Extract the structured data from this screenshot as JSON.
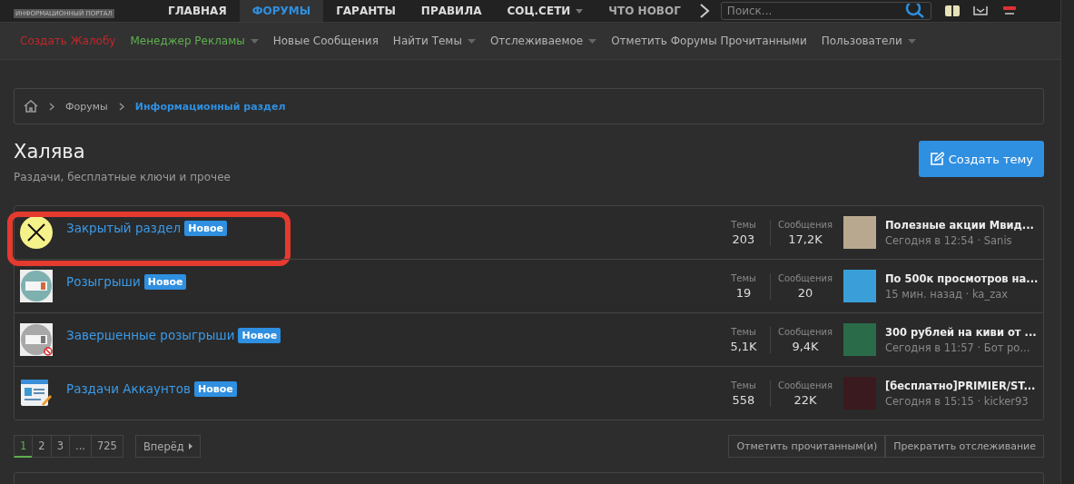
{
  "logo": {
    "tagline": "ИНФОРМАЦИОННЫЙ ПОРТАЛ"
  },
  "main_nav": [
    {
      "label": "ГЛАВНАЯ",
      "selected": false,
      "dropdown": false
    },
    {
      "label": "ФОРУМЫ",
      "selected": true,
      "dropdown": false
    },
    {
      "label": "ГАРАНТЫ",
      "selected": false,
      "dropdown": false
    },
    {
      "label": "ПРАВИЛА",
      "selected": false,
      "dropdown": false
    },
    {
      "label": "СОЦ.СЕТИ",
      "selected": false,
      "dropdown": true
    },
    {
      "label": "ЧТО НОВОГ",
      "selected": false,
      "dropdown": false
    }
  ],
  "search": {
    "placeholder": "Поиск..."
  },
  "sub_nav": [
    {
      "label": "Создать Жалобу",
      "color": "#c0282a",
      "dropdown": false
    },
    {
      "label": "Менеджер Рекламы",
      "color": "#5fae4f",
      "dropdown": true
    },
    {
      "label": "Новые Сообщения",
      "color": "#b4b4b4",
      "dropdown": false
    },
    {
      "label": "Найти Темы",
      "color": "#b4b4b4",
      "dropdown": true
    },
    {
      "label": "Отслеживаемое",
      "color": "#b4b4b4",
      "dropdown": true
    },
    {
      "label": "Отметить Форумы Прочитанными",
      "color": "#b4b4b4",
      "dropdown": false
    },
    {
      "label": "Пользователи",
      "color": "#b4b4b4",
      "dropdown": true
    }
  ],
  "breadcrumbs": [
    {
      "label": "Форумы",
      "selected": false
    },
    {
      "label": "Информационный раздел",
      "selected": true
    }
  ],
  "page": {
    "title": "Халява",
    "description": "Раздачи, бесплатные ключи и прочее",
    "create_button": "Создать тему"
  },
  "forums": [
    {
      "kind": "closed",
      "title": "Закрытый раздел",
      "badge": "Новое",
      "highlighted": true,
      "threads_label": "Темы",
      "threads": "203",
      "posts_label": "Сообщения",
      "posts": "17,2K",
      "last_title": "Полезные акции Мвид...",
      "last_meta": "Сегодня в 12:54 · Sanis"
    },
    {
      "kind": "ticket",
      "title": "Розыгрыши",
      "badge": "Новое",
      "highlighted": false,
      "threads_label": "Темы",
      "threads": "19",
      "posts_label": "Сообщения",
      "posts": "20",
      "last_title": "По 500к просмотров на...",
      "last_meta": "15 мин. назад · ka_zax"
    },
    {
      "kind": "ticket_ended",
      "title": "Завершенные розыгрыши",
      "badge": "Новое",
      "highlighted": false,
      "threads_label": "Темы",
      "threads": "5,1K",
      "posts_label": "Сообщения",
      "posts": "9,4K",
      "last_title": "300 рублей на киви от ...",
      "last_meta": "Сегодня в 11:57 · Бот ро..."
    },
    {
      "kind": "account",
      "title": "Раздачи Аккаунтов",
      "badge": "Новое",
      "highlighted": false,
      "threads_label": "Темы",
      "threads": "558",
      "posts_label": "Сообщения",
      "posts": "22K",
      "last_title": "[бесплатно]PRIMIER/ST...",
      "last_meta": "Сегодня в 15:15 · kicker93"
    }
  ],
  "pagination": {
    "pages": [
      {
        "label": "1",
        "selected": true
      },
      {
        "label": "2",
        "selected": false
      },
      {
        "label": "3",
        "selected": false
      },
      {
        "label": "...",
        "selected": false
      },
      {
        "label": "725",
        "selected": false
      }
    ],
    "next": "Вперёд"
  },
  "actions": [
    "Отметить прочитанным(и)",
    "Прекратить отслеживание"
  ]
}
